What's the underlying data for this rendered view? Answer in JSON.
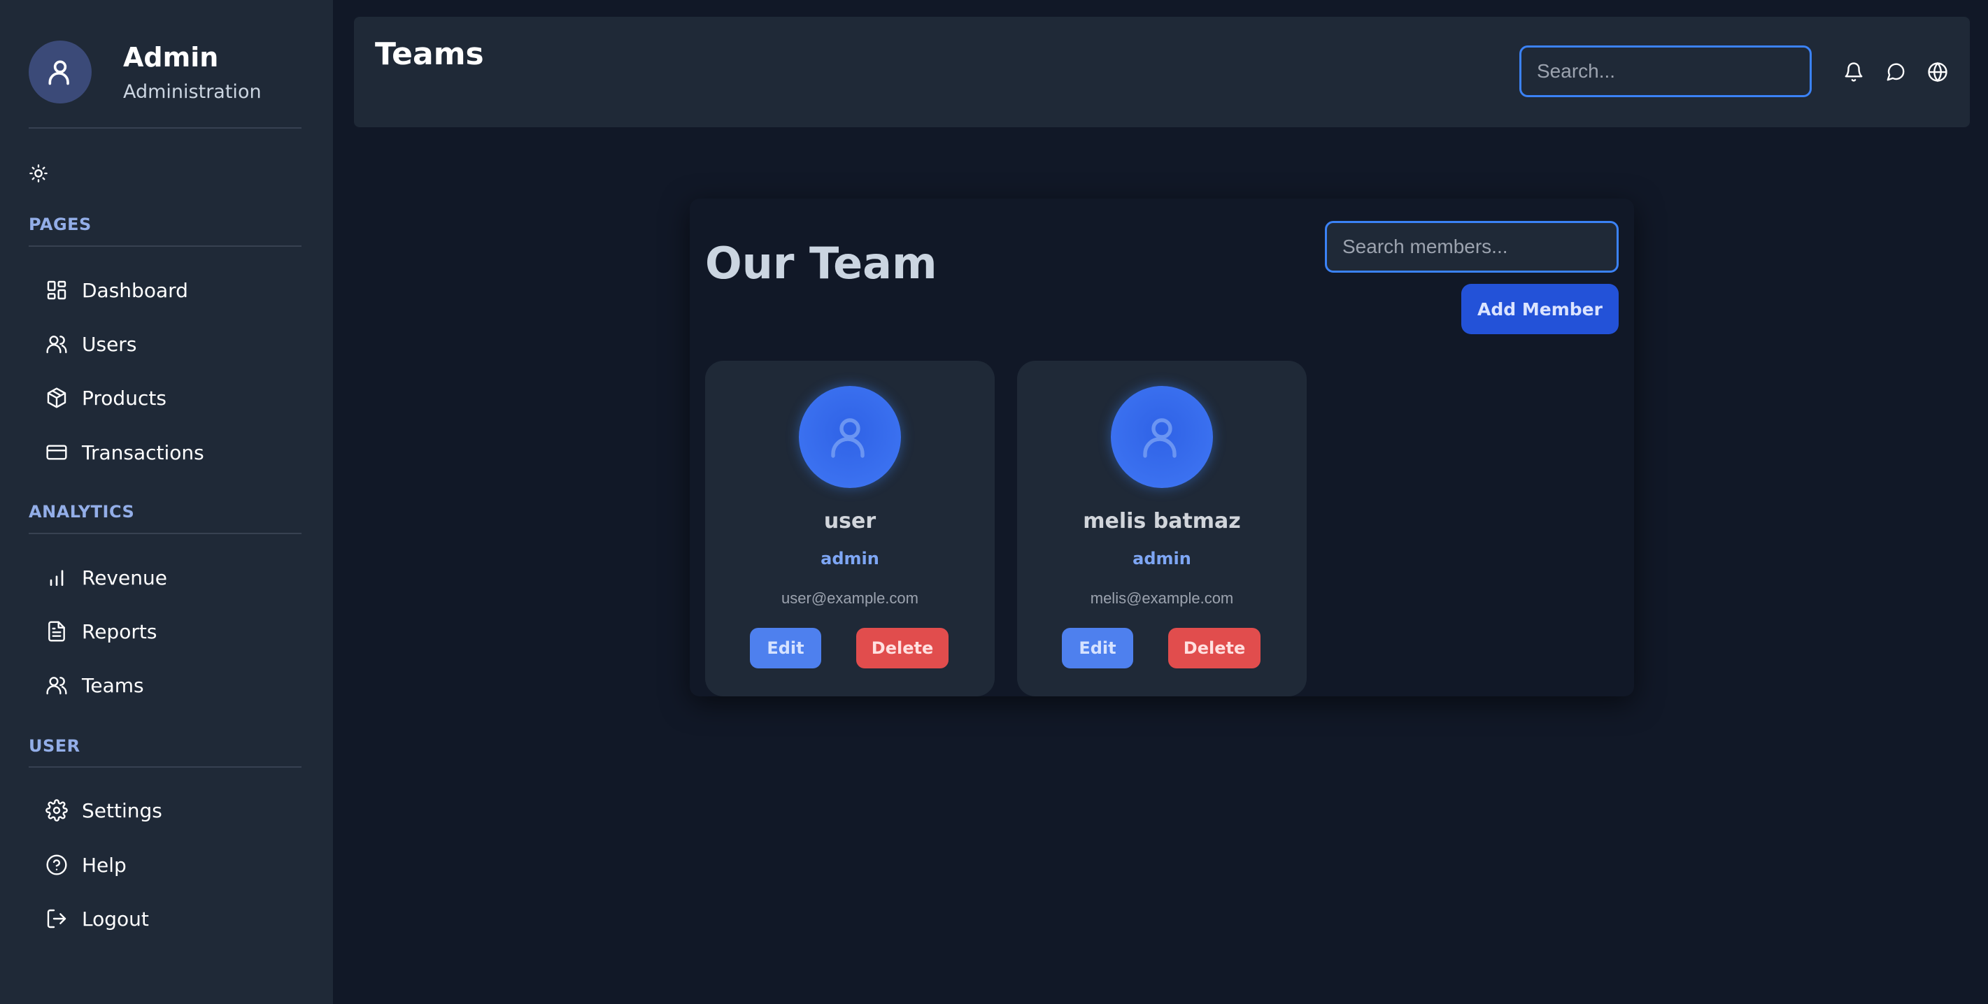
{
  "sidebar": {
    "profile": {
      "name": "Admin",
      "role": "Administration",
      "avatar_icon": "user-icon"
    },
    "theme_toggle_icon": "sun-icon",
    "sections": [
      {
        "title": "PAGES",
        "items": [
          {
            "label": "Dashboard",
            "icon": "dashboard-icon"
          },
          {
            "label": "Users",
            "icon": "users-icon"
          },
          {
            "label": "Products",
            "icon": "box-icon"
          },
          {
            "label": "Transactions",
            "icon": "credit-card-icon"
          }
        ]
      },
      {
        "title": "ANALYTICS",
        "items": [
          {
            "label": "Revenue",
            "icon": "bar-chart-icon"
          },
          {
            "label": "Reports",
            "icon": "document-icon"
          },
          {
            "label": "Teams",
            "icon": "users-icon"
          }
        ]
      },
      {
        "title": "USER",
        "items": [
          {
            "label": "Settings",
            "icon": "gear-icon"
          },
          {
            "label": "Help",
            "icon": "help-circle-icon"
          },
          {
            "label": "Logout",
            "icon": "logout-icon"
          }
        ]
      }
    ]
  },
  "header": {
    "title": "Teams",
    "search_placeholder": "Search...",
    "icons": [
      "bell-icon",
      "chat-icon",
      "globe-icon"
    ]
  },
  "team": {
    "heading": "Our Team",
    "search_placeholder": "Search members...",
    "add_button": "Add Member",
    "members": [
      {
        "name": "user",
        "role": "admin",
        "email": "user@example.com",
        "edit_label": "Edit",
        "delete_label": "Delete"
      },
      {
        "name": "melis batmaz",
        "role": "admin",
        "email": "melis@example.com",
        "edit_label": "Edit",
        "delete_label": "Delete"
      }
    ]
  },
  "colors": {
    "background": "#111827",
    "panel": "#1f2937",
    "accent": "#3b82f6",
    "primary_button": "#2352d8",
    "edit_button": "#4e80ee",
    "danger": "#e14d4d",
    "section_title": "#93aee8"
  }
}
